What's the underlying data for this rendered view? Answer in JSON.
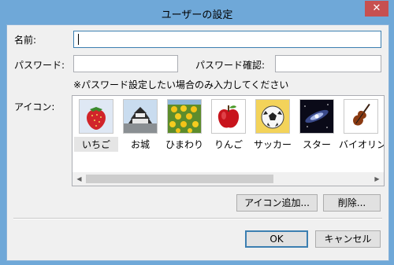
{
  "window": {
    "title": "ユーザーの設定",
    "close_glyph": "✕"
  },
  "form": {
    "name_label": "名前:",
    "name_value": "",
    "password_label": "パスワード:",
    "password_value": "",
    "confirm_label": "パスワード確認:",
    "confirm_value": "",
    "password_note": "※パスワード設定したい場合のみ入力してください",
    "icon_label": "アイコン:"
  },
  "icons": [
    {
      "label": "いちご",
      "icon": "strawberry-icon",
      "selected": true
    },
    {
      "label": "お城",
      "icon": "castle-icon",
      "selected": false
    },
    {
      "label": "ひまわり",
      "icon": "sunflower-icon",
      "selected": false
    },
    {
      "label": "りんご",
      "icon": "apple-icon",
      "selected": false
    },
    {
      "label": "サッカー",
      "icon": "soccer-ball-icon",
      "selected": false
    },
    {
      "label": "スター",
      "icon": "galaxy-icon",
      "selected": false
    },
    {
      "label": "バイオリン",
      "icon": "violin-icon",
      "selected": false
    }
  ],
  "buttons": {
    "add_icon": "アイコン追加...",
    "delete": "削除...",
    "ok": "OK",
    "cancel": "キャンセル"
  },
  "colors": {
    "title_bar": "#6fa8d8",
    "close_button": "#c75050",
    "default_button_border": "#3c7fb1"
  }
}
